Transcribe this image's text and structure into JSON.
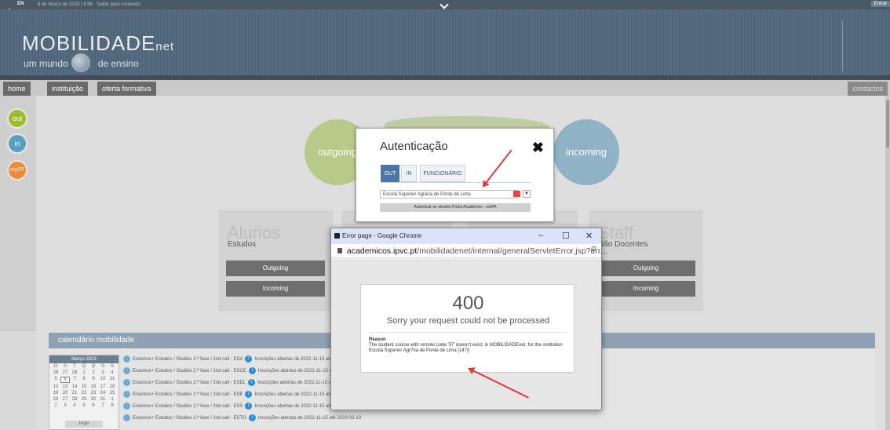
{
  "topbar": {
    "lang": "EN",
    "datetime": "8 de Março de 2023 | 8:56 · Saltar para conteúdo",
    "login": "Entrar"
  },
  "header": {
    "logo_main": "MOBILIDADE",
    "logo_suffix": "net",
    "logo_sub_left": "um mundo",
    "logo_sub_right": "de ensino"
  },
  "nav": {
    "items": [
      "home",
      "instituição",
      "oferta formativa"
    ],
    "contact": "contactos"
  },
  "side": {
    "out": "out",
    "in": "in",
    "my": "myIPI"
  },
  "main": {
    "outgoing": "outgoing",
    "incoming": "incoming",
    "cards": [
      {
        "title": "Alunos",
        "subtitle": "Estudos",
        "btn1": "Outgoing",
        "btn2": "Incoming"
      },
      {
        "title": "Staff",
        "subtitle": "Não Docentes",
        "btn1": "Outgoing",
        "btn2": "Incoming"
      }
    ]
  },
  "calendar": {
    "header": "calendário mobilidade",
    "month": "Março 2023",
    "days": [
      "D",
      "S",
      "T",
      "Q",
      "Q",
      "S",
      "S"
    ],
    "weeks": [
      [
        "26",
        "27",
        "28",
        "1",
        "2",
        "3",
        "4"
      ],
      [
        "5",
        "6",
        "7",
        "8",
        "9",
        "10",
        "11"
      ],
      [
        "12",
        "13",
        "14",
        "15",
        "16",
        "17",
        "18"
      ],
      [
        "19",
        "20",
        "21",
        "22",
        "23",
        "24",
        "25"
      ],
      [
        "26",
        "27",
        "28",
        "29",
        "30",
        "31",
        "1"
      ],
      [
        "2",
        "3",
        "4",
        "5",
        "6",
        "7",
        "8"
      ]
    ],
    "today": "Hoje",
    "events": [
      {
        "text": "Erasmus+ Estudos / Studies 2.ª fase / 2nd call - ESA",
        "info": "Inscrições abertas de 2022-11-15 até 20"
      },
      {
        "text": "Erasmus+ Estudos / Studies 2.ª fase / 2nd call - ESCE",
        "info": "Inscrições abertas de 2022-11-15 até 2"
      },
      {
        "text": "Erasmus+ Estudos / Studies 2.ª fase / 2nd call - ESDL",
        "info": "Inscrições abertas de 2022-11-15 até 2"
      },
      {
        "text": "Erasmus+ Estudos / Studies 2.ª fase / 2nd call - ESE",
        "info": "Inscrições abertas de 2022-11-15 até 20"
      },
      {
        "text": "Erasmus+ Estudos / Studies 2.ª fase / 2nd call - ESS",
        "info": "Inscrições abertas de 2022-11-15 até 20"
      },
      {
        "text": "Erasmus+ Estudos / Studies 2.ª fase / 2nd call - ESTG",
        "info": "Inscrições abertas de 2022-11-15 até 2023-03-13"
      }
    ]
  },
  "auth": {
    "title": "Autenticação",
    "close": "✖",
    "tabs": [
      "OUT",
      "IN",
      "FUNCIONÁRIO"
    ],
    "select_value": "Escola Superior Agrária de Ponte de Lima",
    "button": "Autenticar-se através Portal Académico - netPA"
  },
  "chrome": {
    "title": "Error page - Google Chrome",
    "url_host": "academicos.ipvc.pt",
    "url_path": "/mobilidadenet/internal/generalServletError.jsp?err...",
    "error_code": "400",
    "error_message": "Sorry your request could not be processed",
    "reason_label": "Reason",
    "reason_detail": "The student course with remote code '57' doesn't exist, in MOBILIDADEnet, for the institution Escola Superior Agr?ria de Ponte de Lima [147]!"
  }
}
